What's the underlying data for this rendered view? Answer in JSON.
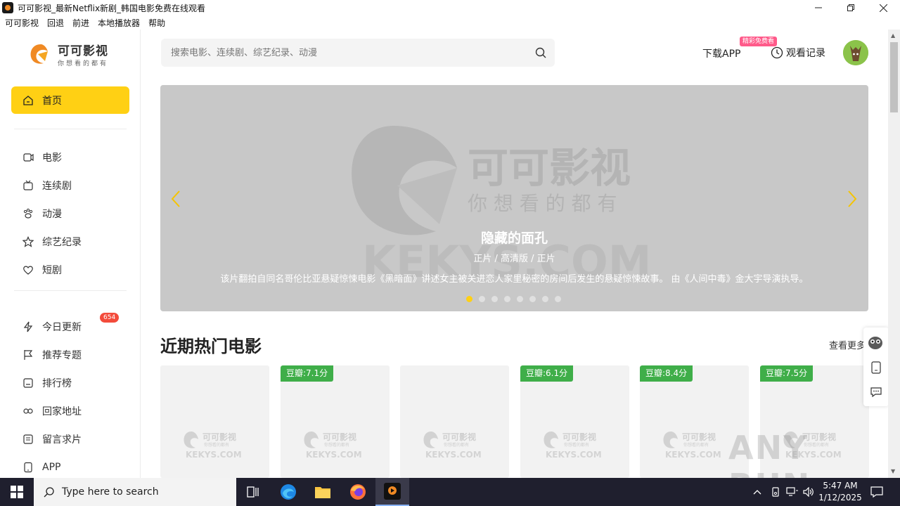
{
  "window": {
    "title": "可可影视_最新Netflix新剧_韩国电影免费在线观看",
    "minimize_icon": "minimize-icon",
    "restore_icon": "restore-icon",
    "close_icon": "close-icon"
  },
  "menubar": {
    "items": [
      "可可影视",
      "回退",
      "前进",
      "本地播放器",
      "帮助"
    ]
  },
  "logo": {
    "name": "可可影视",
    "slogan": "你想看的都有",
    "brand_color": "#f08a24"
  },
  "sidebar": {
    "home_label": "首页",
    "group1": [
      "电影",
      "连续剧",
      "动漫",
      "综艺纪录",
      "短剧"
    ],
    "group2": [
      "今日更新",
      "推荐专题",
      "排行榜",
      "回家地址",
      "留言求片",
      "APP"
    ],
    "update_badge": "654",
    "accent_color": "#ffd014"
  },
  "header": {
    "search_placeholder": "搜索电影、连续剧、综艺纪录、动漫",
    "download_label": "下载APP",
    "promo_badge": "精彩免费看",
    "history_label": "观看记录"
  },
  "banner": {
    "title": "隐藏的面孔",
    "meta": "正片 / 高清版 / 正片",
    "description": "该片翻拍自同名哥伦比亚悬疑惊悚电影《黑暗面》讲述女主被关进恋人家里秘密的房间后发生的悬疑惊悚故事。        由《人间中毒》金大宇导演执导。",
    "watermark_name": "可可影视",
    "watermark_slogan": "你 想 看 的 都 有",
    "watermark_domain": "KEKYS.COM",
    "slide_count": 8,
    "active_slide": 1,
    "prev_icon": "chevron-left-icon",
    "next_icon": "chevron-right-icon"
  },
  "section": {
    "title": "近期热门电影",
    "more_label": "查看更多",
    "cards": [
      {
        "score": ""
      },
      {
        "score": "豆瓣:7.1分"
      },
      {
        "score": ""
      },
      {
        "score": "豆瓣:6.1分"
      },
      {
        "score": "豆瓣:8.4分"
      },
      {
        "score": "豆瓣:7.5分"
      }
    ],
    "placeholder_name": "可可影视",
    "placeholder_slogan": "你想看的都有",
    "placeholder_domain": "KEKYS.COM",
    "score_color": "#3fae49"
  },
  "watermark": {
    "text": "ANY RUN"
  },
  "taskbar": {
    "search_placeholder": "Type here to search",
    "time": "5:47 AM",
    "date": "1/12/2025"
  }
}
